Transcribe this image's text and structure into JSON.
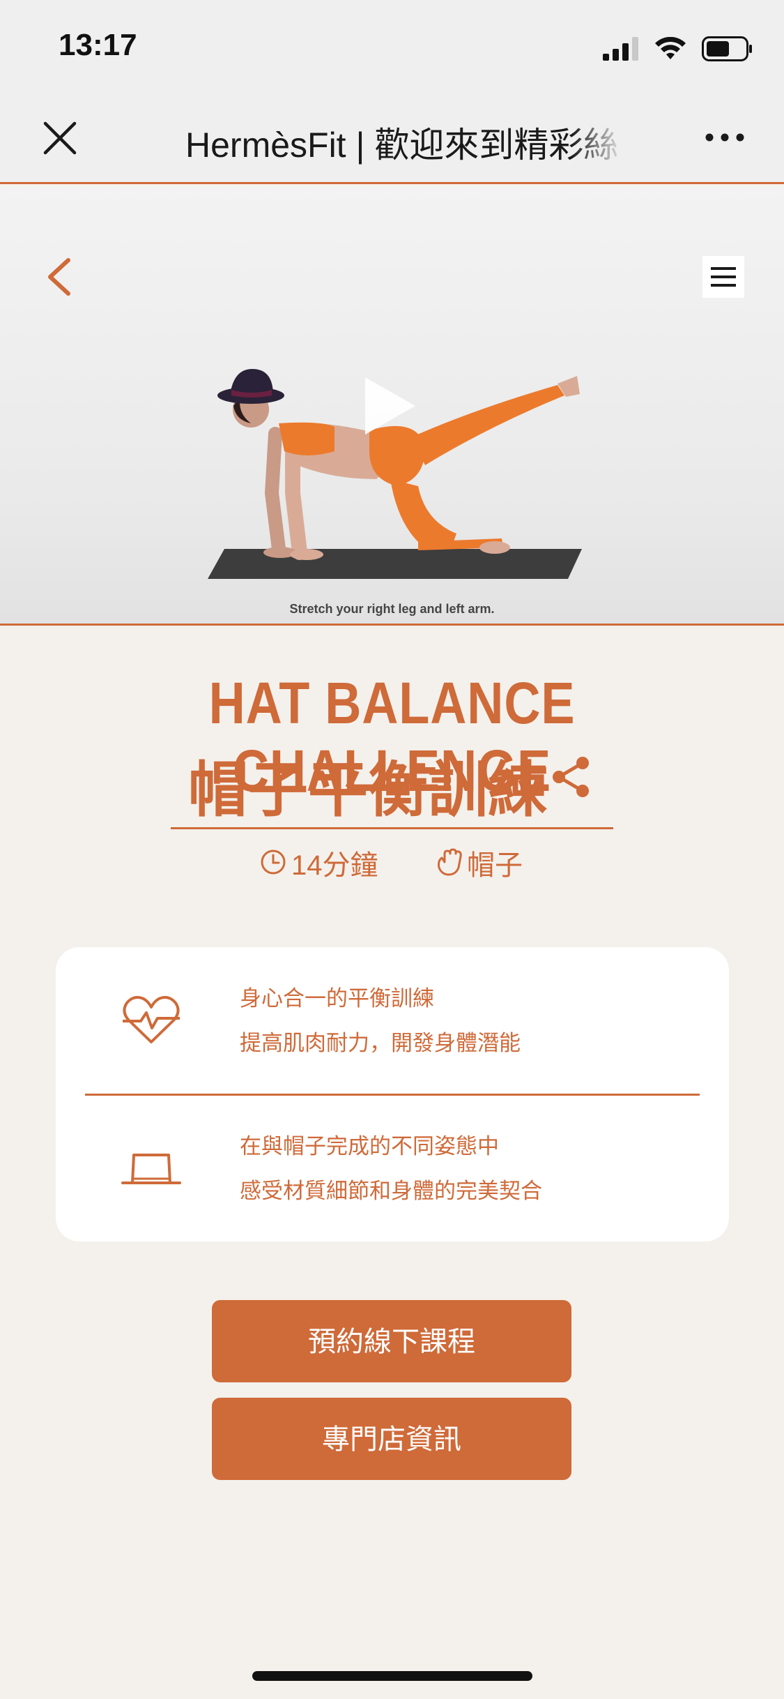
{
  "status_bar": {
    "time": "13:17",
    "icons": [
      "signal-icon",
      "wifi-icon",
      "battery-icon"
    ]
  },
  "nav_bar": {
    "title": "HermèsFit | 歡迎來到精彩絲",
    "icons": [
      "close-icon",
      "more-icon"
    ]
  },
  "video": {
    "caption": "Stretch your right leg and left arm.",
    "icons": [
      "back-chevron-icon",
      "menu-icon",
      "play-icon"
    ]
  },
  "workout": {
    "title_en": "HAT BALANCE CHALLENGE",
    "title_zh": "帽子平衡訓練",
    "duration": "14分鐘",
    "equipment": "帽子",
    "icons": [
      "share-icon",
      "clock-icon",
      "hand-icon"
    ]
  },
  "info_card": {
    "items": [
      {
        "icon": "heart-pulse-icon",
        "line1": "身心合一的平衡訓練",
        "line2": "提高肌肉耐力，開發身體潛能"
      },
      {
        "icon": "hat-icon",
        "line1": "在與帽子完成的不同姿態中",
        "line2": "感受材質細節和身體的完美契合"
      }
    ]
  },
  "buttons": {
    "book": "預約線下課程",
    "store": "專門店資訊"
  },
  "colors": {
    "accent": "#cf6a39",
    "background": "#f4f1ec",
    "card": "#ffffff"
  }
}
